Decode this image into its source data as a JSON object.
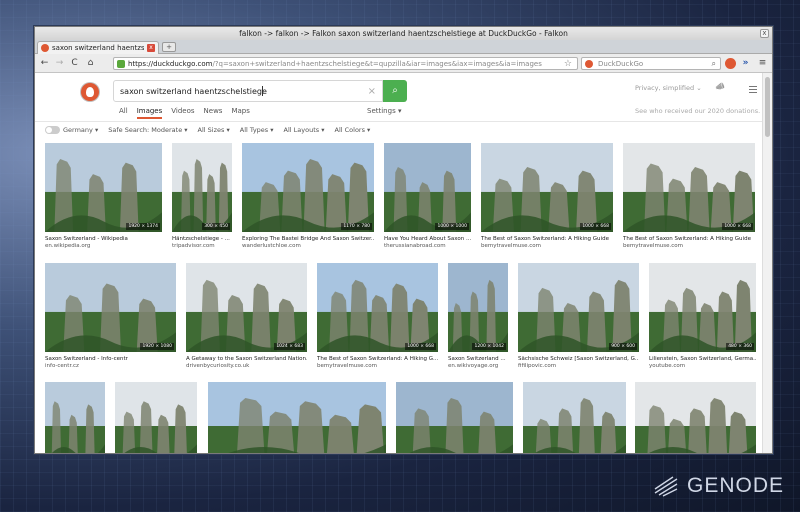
{
  "window": {
    "title": "falkon -> falkon -> Falkon saxon switzerland haentzschelstiege at DuckDuckGo - Falkon",
    "close_glyph": "x"
  },
  "tab": {
    "title": "saxon switzerland haentzsc...",
    "close_glyph": "x",
    "new_tab_glyph": "+"
  },
  "nav": {
    "back_glyph": "←",
    "forward_glyph": "→",
    "reload_glyph": "C",
    "home_glyph": "⌂",
    "url_host": "https://duckduckgo.com",
    "url_rest": "/?q=saxon+switzerland+haentzschelstiege&t=qupzilla&iar=images&iax=images&ia=images",
    "bookmark_glyph": "☆",
    "search_placeholder": "DuckDuckGo",
    "search_glyph": "⌕",
    "forward_more_glyph": "»",
    "menu_glyph": "≡"
  },
  "search": {
    "query": "saxon switzerland haentzschelstiege",
    "clear_glyph": "×",
    "go_glyph": "⌕"
  },
  "header": {
    "privacy_label": "Privacy, simplified",
    "privacy_caret": "⌄",
    "megaphone_glyph": "📣",
    "donations_text": "See who received our 2020 donations."
  },
  "search_tabs": [
    {
      "label": "All",
      "active": false
    },
    {
      "label": "Images",
      "active": true
    },
    {
      "label": "Videos",
      "active": false
    },
    {
      "label": "News",
      "active": false
    },
    {
      "label": "Maps",
      "active": false
    }
  ],
  "settings_label": "Settings",
  "filters": {
    "region": "Germany",
    "safe_search": "Safe Search: Moderate",
    "size": "All Sizes",
    "type": "All Types",
    "layout": "All Layouts",
    "color": "All Colors"
  },
  "results": [
    {
      "caption": "Saxon Switzerland - Wikipedia",
      "domain": "en.wikipedia.org",
      "dims": "1920 × 1374"
    },
    {
      "caption": "Häntzschelstiege - ...",
      "domain": "tripadvisor.com",
      "dims": "300 × 450"
    },
    {
      "caption": "Exploring The Bastei Bridge And Saxon Switzer...",
      "domain": "wanderlustchloe.com",
      "dims": "1170 × 780"
    },
    {
      "caption": "Have You Heard About Saxon ...",
      "domain": "therussianabroad.com",
      "dims": "1000 × 1000"
    },
    {
      "caption": "The Best of Saxon Switzerland: A Hiking Guide",
      "domain": "bemytravelmuse.com",
      "dims": "1000 × 668"
    },
    {
      "caption": "The Best of Saxon Switzerland: A Hiking Guide",
      "domain": "bemytravelmuse.com",
      "dims": "1000 × 668"
    },
    {
      "caption": "Saxon Switzerland - Info-centr",
      "domain": "info-centr.cz",
      "dims": "1920 × 1080"
    },
    {
      "caption": "A Getaway to the Saxon Switzerland Nation...",
      "domain": "drivenbycuriosity.co.uk",
      "dims": "1024 × 683"
    },
    {
      "caption": "The Best of Saxon Switzerland: A Hiking G...",
      "domain": "bemytravelmuse.com",
      "dims": "1000 × 668"
    },
    {
      "caption": "Saxon Switzerland ...",
      "domain": "en.wikivoyage.org",
      "dims": "1200 × 1042"
    },
    {
      "caption": "Sächsische Schweiz [Saxon Switzerland, G...",
      "domain": "fifilipovic.com",
      "dims": "900 × 600"
    },
    {
      "caption": "Lilienstein, Saxon Switzerland, Germa...",
      "domain": "youtube.com",
      "dims": "480 × 360"
    },
    {
      "caption": "",
      "domain": "",
      "dims": ""
    },
    {
      "caption": "",
      "domain": "",
      "dims": ""
    },
    {
      "caption": "",
      "domain": "",
      "dims": ""
    },
    {
      "caption": "",
      "domain": "",
      "dims": ""
    },
    {
      "caption": "",
      "domain": "",
      "dims": ""
    },
    {
      "caption": "",
      "domain": "",
      "dims": ""
    }
  ],
  "desktop": {
    "logo_text": "GENODE"
  },
  "colors": {
    "accent": "#de5833",
    "search_button": "#4caf50",
    "rock": "#7e8470",
    "forest": "#3f6b34",
    "sky": "#b9cbdc"
  }
}
